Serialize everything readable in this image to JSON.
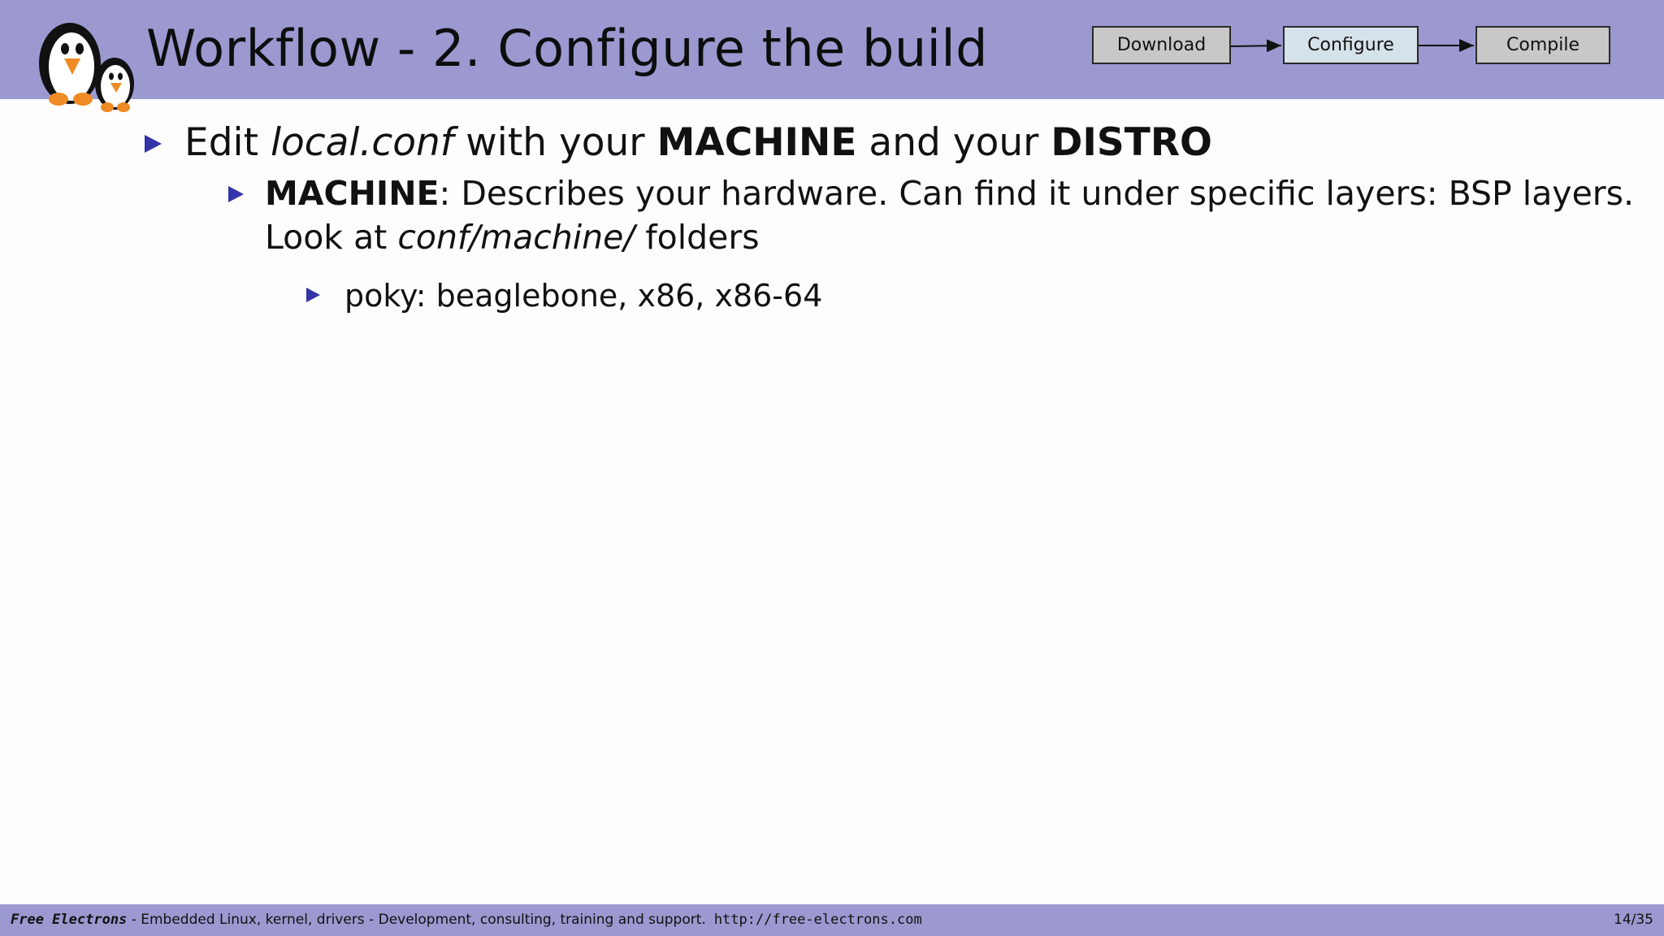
{
  "header": {
    "title": "Workflow - 2.  Configure the build",
    "workflow": {
      "steps": [
        "Download",
        "Configure",
        "Compile"
      ],
      "active_step": "Configure"
    }
  },
  "content": {
    "bullet1": {
      "parts": [
        "Edit ",
        "local.conf",
        " with your ",
        "MACHINE",
        " and your ",
        "DISTRO"
      ]
    },
    "bullet2": {
      "line1": [
        "MACHINE",
        ": Describes your hardware.  Can find it under specific layers: BSP layers."
      ],
      "line2": [
        "Look at ",
        "conf/machine/",
        " folders"
      ]
    },
    "bullet3": {
      "text": "poky:  beaglebone, x86, x86-64"
    }
  },
  "footer": {
    "brand": "Free Electrons",
    "tagline": " - Embedded Linux, kernel, drivers - Development, consulting, training and support.",
    "url": "http://free-electrons.com",
    "page": "14/35"
  },
  "colors": {
    "header_bg": "#9b99d0",
    "bullet": "#3333aa",
    "active_step_bg": "#d6e2ea",
    "inactive_step_bg": "#c8c8c8"
  },
  "icons": [
    "penguin-logo-icon",
    "triangle-bullet-icon",
    "arrow-right-icon"
  ]
}
